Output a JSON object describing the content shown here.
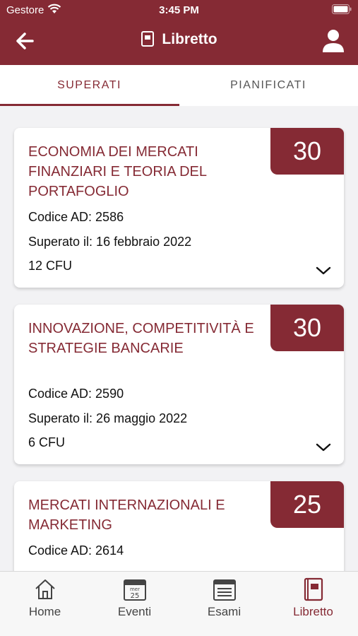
{
  "status": {
    "carrier": "Gestore",
    "time": "3:45 PM"
  },
  "header": {
    "title": "Libretto"
  },
  "tabs": [
    {
      "label": "SUPERATI",
      "active": true
    },
    {
      "label": "PIANIFICATI",
      "active": false
    }
  ],
  "exams": [
    {
      "title": "ECONOMIA DEI MERCATI FINANZIARI E TEORIA DEL PORTAFOGLIO",
      "grade": "30",
      "code": "Codice AD: 2586",
      "passed": "Superato il: 16 febbraio 2022",
      "cfu": "12 CFU"
    },
    {
      "title": "INNOVAZIONE, COMPETITIVITÀ E STRATEGIE BANCARIE",
      "grade": "30",
      "code": "Codice AD: 2590",
      "passed": "Superato il: 26 maggio 2022",
      "cfu": "6 CFU"
    },
    {
      "title": "MERCATI INTERNAZIONALI E MARKETING",
      "grade": "25",
      "code": "Codice AD: 2614"
    }
  ],
  "tabbar": {
    "items": [
      {
        "label": "Home",
        "icon": "home-icon"
      },
      {
        "label": "Eventi",
        "icon": "calendar-icon",
        "calendar_day": "mer",
        "calendar_date": "25"
      },
      {
        "label": "Esami",
        "icon": "list-icon"
      },
      {
        "label": "Libretto",
        "icon": "book-icon",
        "active": true
      }
    ]
  },
  "colors": {
    "primary": "#852a34",
    "background": "#f2f2f4"
  }
}
